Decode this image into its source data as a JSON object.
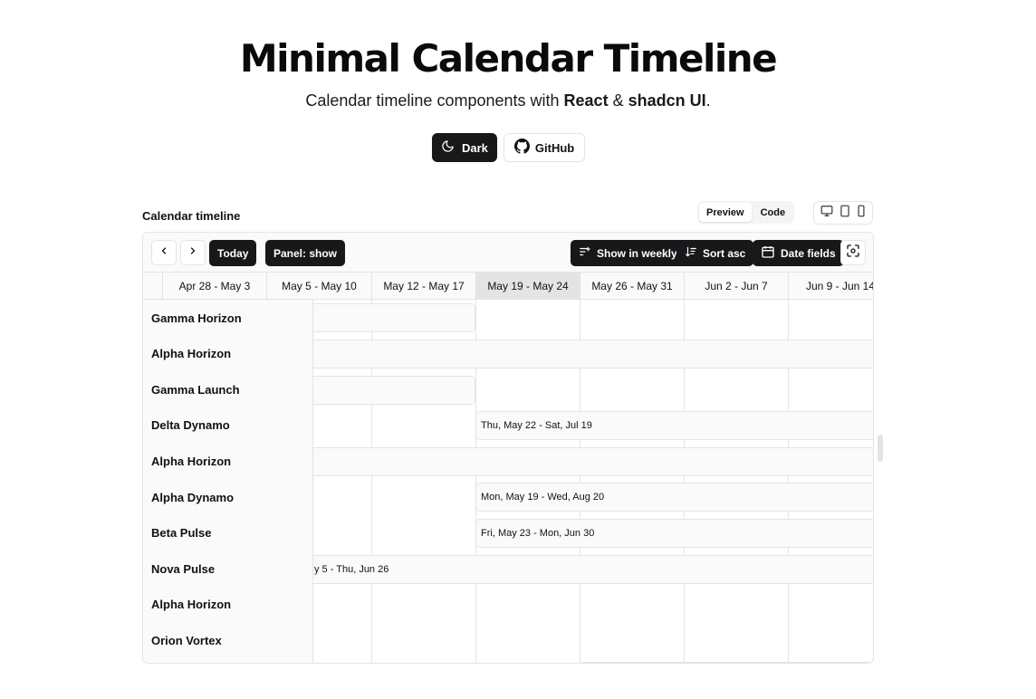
{
  "hero": {
    "title": "Minimal Calendar Timeline",
    "subtitle_prefix": "Calendar timeline components with ",
    "subtitle_react": "React",
    "subtitle_amp": " & ",
    "subtitle_shadcn": "shadcn UI",
    "subtitle_suffix": ".",
    "dark_button": "Dark",
    "github_button": "GitHub"
  },
  "section": {
    "label": "Calendar timeline",
    "tabs": [
      "Preview",
      "Code"
    ],
    "active_tab": "Preview"
  },
  "toolbar": {
    "today": "Today",
    "panel": "Panel: show",
    "show_in_weekly": "Show in weekly",
    "sort": "Sort asc",
    "date_fields": "Date fields"
  },
  "weeks": [
    "Apr 28 - May 3",
    "May 5 - May 10",
    "May 12 - May 17",
    "May 19 - May 24",
    "May 26 - May 31",
    "Jun 2 - Jun 7",
    "Jun 9 - Jun 14"
  ],
  "current_week": "May 19 - May 24",
  "rows": [
    {
      "name": "Gamma Horizon",
      "bar_label": ""
    },
    {
      "name": "Alpha Horizon",
      "bar_label": ""
    },
    {
      "name": "Gamma Launch",
      "bar_label": ""
    },
    {
      "name": "Delta Dynamo",
      "bar_label": "Thu, May 22 - Sat, Jul 19"
    },
    {
      "name": "Alpha Horizon",
      "bar_label": ""
    },
    {
      "name": "Alpha Dynamo",
      "bar_label": "Mon, May 19 - Wed, Aug 20"
    },
    {
      "name": "Beta Pulse",
      "bar_label": "Fri, May 23 - Mon, Jun 30"
    },
    {
      "name": "Nova Pulse",
      "bar_label": "y 5 - Thu, Jun 26"
    },
    {
      "name": "Alpha Horizon",
      "bar_label": ""
    },
    {
      "name": "Orion Vortex",
      "bar_label": ""
    }
  ],
  "colors": {
    "primary": "#18181b",
    "border": "#e4e4e7",
    "muted": "#fafafa",
    "current_week": "#e4e4e7"
  },
  "icons": {
    "dark": "moon-icon",
    "github": "github-icon",
    "prev": "chevron-left-icon",
    "next": "chevron-right-icon",
    "weekly": "filter-lines-icon",
    "sort": "sort-ascending-icon",
    "date_fields": "calendar-icon",
    "screenshot": "focus-icon"
  }
}
